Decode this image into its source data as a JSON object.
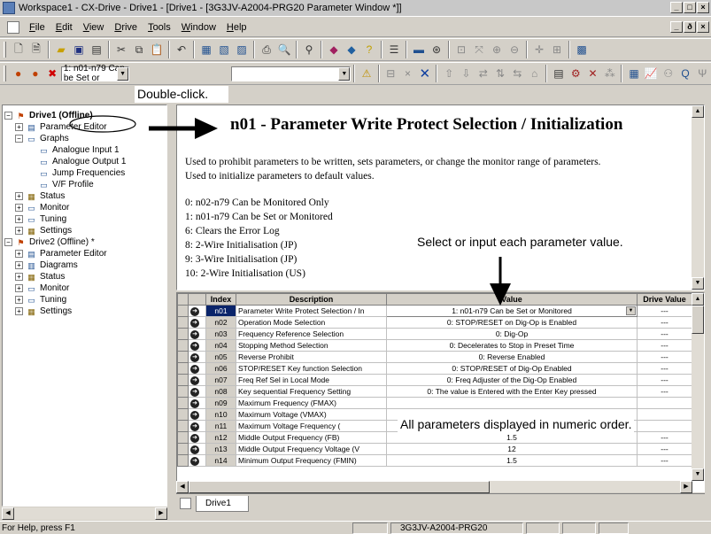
{
  "window": {
    "title": "Workspace1 - CX-Drive - Drive1 - [Drive1 - [3G3JV-A2004-PRG20 Parameter Window *]]",
    "btn_min": "_",
    "btn_max": "□",
    "btn_close": "×",
    "mdi_min": "_",
    "mdi_restore": "ð",
    "mdi_close": "×"
  },
  "menu": {
    "items": [
      {
        "label": "File",
        "u": "F",
        "rest": "ile"
      },
      {
        "label": "Edit",
        "u": "E",
        "rest": "dit"
      },
      {
        "label": "View",
        "u": "V",
        "rest": "iew"
      },
      {
        "label": "Drive",
        "u": "D",
        "rest": "rive"
      },
      {
        "label": "Tools",
        "u": "T",
        "rest": "ools"
      },
      {
        "label": "Window",
        "u": "W",
        "rest": "indow"
      },
      {
        "label": "Help",
        "u": "H",
        "rest": "elp"
      }
    ]
  },
  "toolbar2": {
    "param_combo_value": "1: n01-n79 Can be Set or"
  },
  "tree": {
    "nodes": [
      {
        "label": "Drive1 (Offline)",
        "bold": true
      },
      {
        "label": "Parameter Editor"
      },
      {
        "label": "Graphs"
      },
      {
        "label": "Analogue Input 1"
      },
      {
        "label": "Analogue Output 1"
      },
      {
        "label": "Jump Frequencies"
      },
      {
        "label": "V/F Profile"
      },
      {
        "label": "Status"
      },
      {
        "label": "Monitor"
      },
      {
        "label": "Tuning"
      },
      {
        "label": "Settings"
      },
      {
        "label": "Drive2 (Offline) *"
      },
      {
        "label": "Parameter Editor"
      },
      {
        "label": "Diagrams"
      },
      {
        "label": "Status"
      },
      {
        "label": "Monitor"
      },
      {
        "label": "Tuning"
      },
      {
        "label": "Settings"
      }
    ]
  },
  "help": {
    "title": "n01 - Parameter Write Protect Selection / Initialization",
    "desc1": "Used to prohibit parameters to be written, sets parameters, or change the monitor range of parameters.",
    "desc2": "Used to initialize parameters to default values.",
    "options": [
      "0: n02-n79 Can be Monitored Only",
      "1: n01-n79 Can be Set or Monitored",
      "6: Clears the Error Log",
      "8: 2-Wire Initialisation (JP)",
      "9: 3-Wire Initialisation (JP)",
      "10: 2-Wire Initialisation (US)"
    ]
  },
  "grid": {
    "headers": {
      "index": "Index",
      "description": "Description",
      "value": "Value",
      "drive_value": "Drive Value"
    },
    "rows": [
      {
        "index": "n01",
        "description": "Parameter Write Protect Selection / In",
        "value": "1: n01-n79 Can be Set or Monitored",
        "drive": "---"
      },
      {
        "index": "n02",
        "description": "Operation Mode Selection",
        "value": "0: STOP/RESET on Dig-Op is Enabled",
        "drive": "---"
      },
      {
        "index": "n03",
        "description": "Frequency Reference Selection",
        "value": "0: Dig-Op",
        "drive": "---"
      },
      {
        "index": "n04",
        "description": "Stopping Method Selection",
        "value": "0: Decelerates to Stop in Preset Time",
        "drive": "---"
      },
      {
        "index": "n05",
        "description": "Reverse Prohibit",
        "value": "0: Reverse Enabled",
        "drive": "---"
      },
      {
        "index": "n06",
        "description": "STOP/RESET Key function Selection",
        "value": "0: STOP/RESET of Dig-Op Enabled",
        "drive": "---"
      },
      {
        "index": "n07",
        "description": "Freq Ref Sel in Local Mode",
        "value": "0: Freq Adjuster of the Dig-Op Enabled",
        "drive": "---"
      },
      {
        "index": "n08",
        "description": "Key sequential Frequency Setting",
        "value": "0: The value is Entered with the Enter Key pressed",
        "drive": "---"
      },
      {
        "index": "n09",
        "description": "Maximum Frequency (FMAX)",
        "value": "",
        "drive": ""
      },
      {
        "index": "n10",
        "description": "Maximum Voltage (VMAX)",
        "value": "",
        "drive": ""
      },
      {
        "index": "n11",
        "description": "Maximum Voltage Frequency (",
        "value": "",
        "drive": ""
      },
      {
        "index": "n12",
        "description": "Middle Output Frequency (FB)",
        "value": "1.5",
        "drive": "---"
      },
      {
        "index": "n13",
        "description": "Middle Output Frequency Voltage (V",
        "value": "12",
        "drive": "---"
      },
      {
        "index": "n14",
        "description": "Minimum Output Frequency (FMIN)",
        "value": "1.5",
        "drive": "---"
      }
    ]
  },
  "tab": {
    "label": "Drive1"
  },
  "status": {
    "text": "For Help, press F1",
    "model": "3G3JV-A2004-PRG20"
  },
  "annotations": {
    "double_click": "Double-click.",
    "select_input": "Select or input each parameter value.",
    "all_params": "All parameters displayed in numeric order."
  }
}
